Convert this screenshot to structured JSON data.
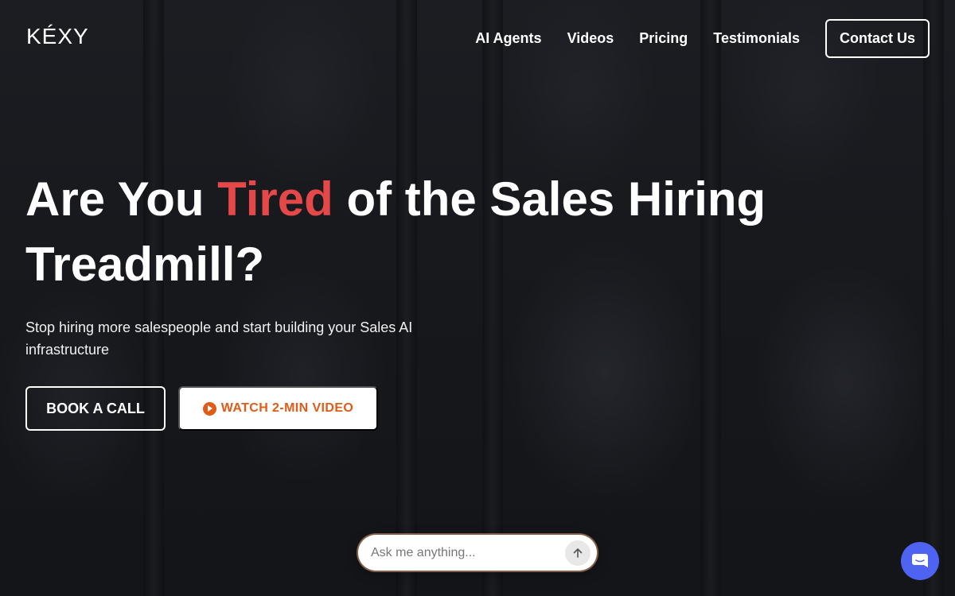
{
  "brand": {
    "logo_text": "KÉXY"
  },
  "nav": {
    "links": [
      "AI Agents",
      "Videos",
      "Pricing",
      "Testimonials"
    ],
    "contact_label": "Contact Us"
  },
  "hero": {
    "headline_before": "Are You ",
    "headline_accent": "Tired",
    "headline_after": " of the Sales Hiring Treadmill?",
    "subtitle": "Stop hiring more salespeople and start building your Sales AI infrastructure",
    "book_call_label": "BOOK A CALL",
    "watch_video_label": "WATCH 2-MIN VIDEO"
  },
  "ask": {
    "placeholder": "Ask me anything..."
  },
  "icons": {
    "play": "play-circle-icon",
    "send": "arrow-up-icon",
    "chat": "chat-bubble-icon"
  },
  "colors": {
    "accent_red": "#e54848",
    "video_orange": "#e15a17",
    "chat_blue": "#4f63f2"
  }
}
